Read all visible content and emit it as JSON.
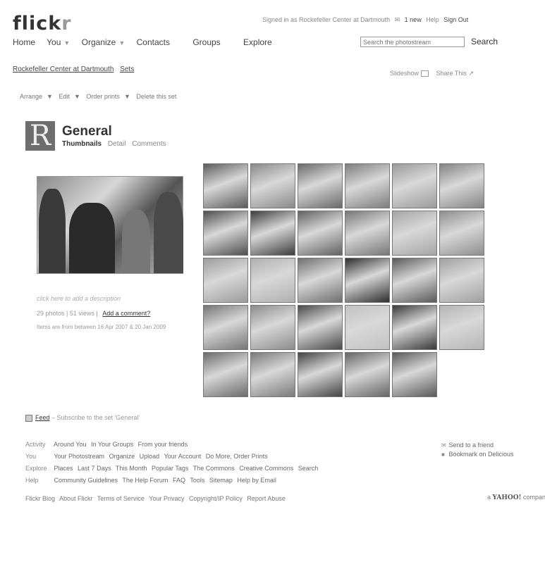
{
  "header": {
    "logo_main": "flick",
    "logo_tail": "r",
    "signed_in": "Signed in as Rockefeller Center at Dartmouth",
    "mail": "1 new",
    "help": "Help",
    "sign_out": "Sign Out"
  },
  "nav": {
    "home": "Home",
    "you": "You",
    "organize": "Organize",
    "contacts": "Contacts",
    "groups": "Groups",
    "explore": "Explore",
    "search_placeholder": "Search the photostream",
    "search_button": "Search"
  },
  "breadcrumb": {
    "owner": "Rockefeller Center at Dartmouth",
    "sets": "Sets"
  },
  "toolbar": {
    "slideshow": "Slideshow",
    "share": "Share This"
  },
  "actions": {
    "arrange": "Arrange",
    "edit": "Edit",
    "order_prints": "Order prints",
    "delete": "Delete this set"
  },
  "set": {
    "thumb_letter": "R",
    "title": "General",
    "tab_thumbnails": "Thumbnails",
    "tab_detail": "Detail",
    "tab_comments": "Comments",
    "description_prompt": "click here to add a description",
    "photo_count": "29 photos",
    "views": "51 views",
    "add_comment": "Add a comment?",
    "date_range": "Items are from between 16 Apr 2007 & 20 Jan 2009"
  },
  "grid": {
    "tile_count": 29,
    "tile_shades": [
      "#5c5c5c",
      "#8a8a8a",
      "#6a6a6a",
      "#7d7d7d",
      "#9a9a9a",
      "#848484",
      "#4f4f4f",
      "#3e3e3e",
      "#626262",
      "#777777",
      "#a5a5a5",
      "#8e8e8e",
      "#9c9c9c",
      "#b0b0b0",
      "#6f6f6f",
      "#2f2f2f",
      "#5a5a5a",
      "#a0a0a0",
      "#767676",
      "#8c8c8c",
      "#4a4a4a",
      "#c2c2c2",
      "#3a3a3a",
      "#b5b5b5",
      "#6c6c6c",
      "#7a7a7a",
      "#444444",
      "#666666",
      "#595959"
    ]
  },
  "feed": {
    "label": "Feed",
    "text": "– Subscribe to the set 'General'"
  },
  "footer": {
    "rows": [
      {
        "head": "Activity",
        "links": [
          "Around You",
          "In Your Groups",
          "From your friends"
        ]
      },
      {
        "head": "You",
        "links": [
          "Your Photostream",
          "Organize",
          "Upload",
          "Your Account",
          "Do More, Order Prints"
        ]
      },
      {
        "head": "Explore",
        "links": [
          "Places",
          "Last 7 Days",
          "This Month",
          "Popular Tags",
          "The Commons",
          "Creative Commons",
          "Search"
        ]
      },
      {
        "head": "Help",
        "links": [
          "Community Guidelines",
          "The Help Forum",
          "FAQ",
          "Tools",
          "Sitemap",
          "Help by Email"
        ]
      }
    ],
    "send_to_friend": "Send to a friend",
    "bookmark": "Bookmark on Delicious",
    "bottom_links": [
      "Flickr Blog",
      "About Flickr",
      "Terms of Service",
      "Your Privacy",
      "Copyright/IP Policy",
      "Report Abuse"
    ],
    "yahoo_prefix": "a",
    "yahoo_brand": "YAHOO!",
    "yahoo_suffix": "company"
  }
}
